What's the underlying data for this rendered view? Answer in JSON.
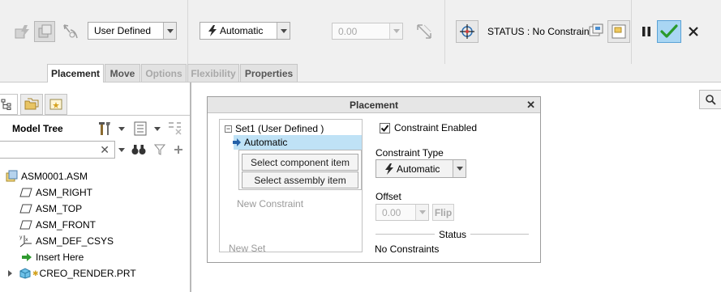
{
  "toolbar": {
    "constraint_set_value": "User Defined",
    "constraint_type_value": "Automatic",
    "offset_value": "0.00",
    "status_text": "STATUS : No Constraints"
  },
  "tabs": [
    {
      "label": "Placement",
      "state": "active"
    },
    {
      "label": "Move",
      "state": "normal"
    },
    {
      "label": "Options",
      "state": "disabled"
    },
    {
      "label": "Flexibility",
      "state": "disabled"
    },
    {
      "label": "Properties",
      "state": "normal"
    }
  ],
  "model_tree": {
    "title": "Model Tree",
    "search_value": "",
    "items": [
      {
        "label": "ASM0001.ASM",
        "icon": "assembly-icon"
      },
      {
        "label": "ASM_RIGHT",
        "icon": "datum-plane-icon"
      },
      {
        "label": "ASM_TOP",
        "icon": "datum-plane-icon"
      },
      {
        "label": "ASM_FRONT",
        "icon": "datum-plane-icon"
      },
      {
        "label": "ASM_DEF_CSYS",
        "icon": "csys-icon"
      },
      {
        "label": "Insert Here",
        "icon": "insert-arrow-icon"
      },
      {
        "label": "CREO_RENDER.PRT",
        "icon": "part-icon"
      }
    ]
  },
  "placement_dialog": {
    "title": "Placement",
    "set_label": "Set1 (User Defined )",
    "constraint_item": "Automatic",
    "select_component_label": "Select component item",
    "select_assembly_label": "Select assembly item",
    "new_constraint_label": "New Constraint",
    "new_set_label": "New Set",
    "constraint_enabled_label": "Constraint Enabled",
    "constraint_enabled_checked": true,
    "constraint_type_label": "Constraint Type",
    "constraint_type_value": "Automatic",
    "offset_label": "Offset",
    "offset_value": "0.00",
    "flip_label": "Flip",
    "status_heading": "Status",
    "status_value": "No Constraints"
  },
  "colors": {
    "accent_green": "#2a9a2a",
    "selection_blue": "#bfe2f6",
    "ribbon_bg": "#f0f0f0"
  }
}
